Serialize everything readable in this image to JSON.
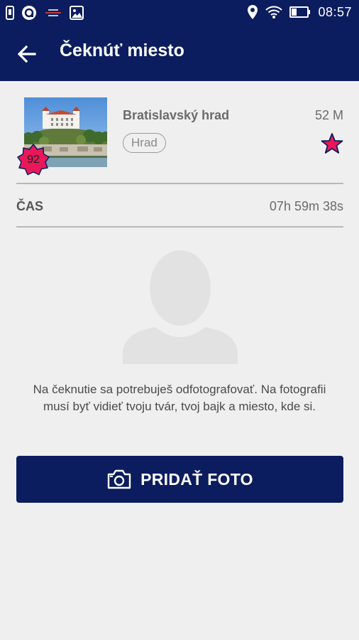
{
  "status_bar": {
    "time": "08:57",
    "left_icons": [
      "sim-card-icon",
      "app-notification-icon",
      "signal-strength-notification-icon",
      "image-notification-icon"
    ],
    "right_icons": [
      "location-icon",
      "wifi-icon",
      "battery-icon"
    ]
  },
  "app_bar": {
    "title": "Čeknúť miesto",
    "back_icon": "arrow-left-icon"
  },
  "place": {
    "name": "Bratislavský hrad",
    "category": "Hrad",
    "distance": "52 M",
    "score": "92",
    "favorite_icon": "star-icon"
  },
  "time_row": {
    "label": "ČAS",
    "value": "07h 59m 38s"
  },
  "instructions": "Na čeknutie sa potrebuješ odfotografovať. Na fotografii musí byť vidieť tvoju tvár, tvoj bajk a miesto, kde si.",
  "add_photo": {
    "label": "PRIDAŤ FOTO",
    "icon": "camera-icon"
  },
  "colors": {
    "primary": "#0b1d5e",
    "accent": "#e8185a",
    "background": "#efefef"
  }
}
